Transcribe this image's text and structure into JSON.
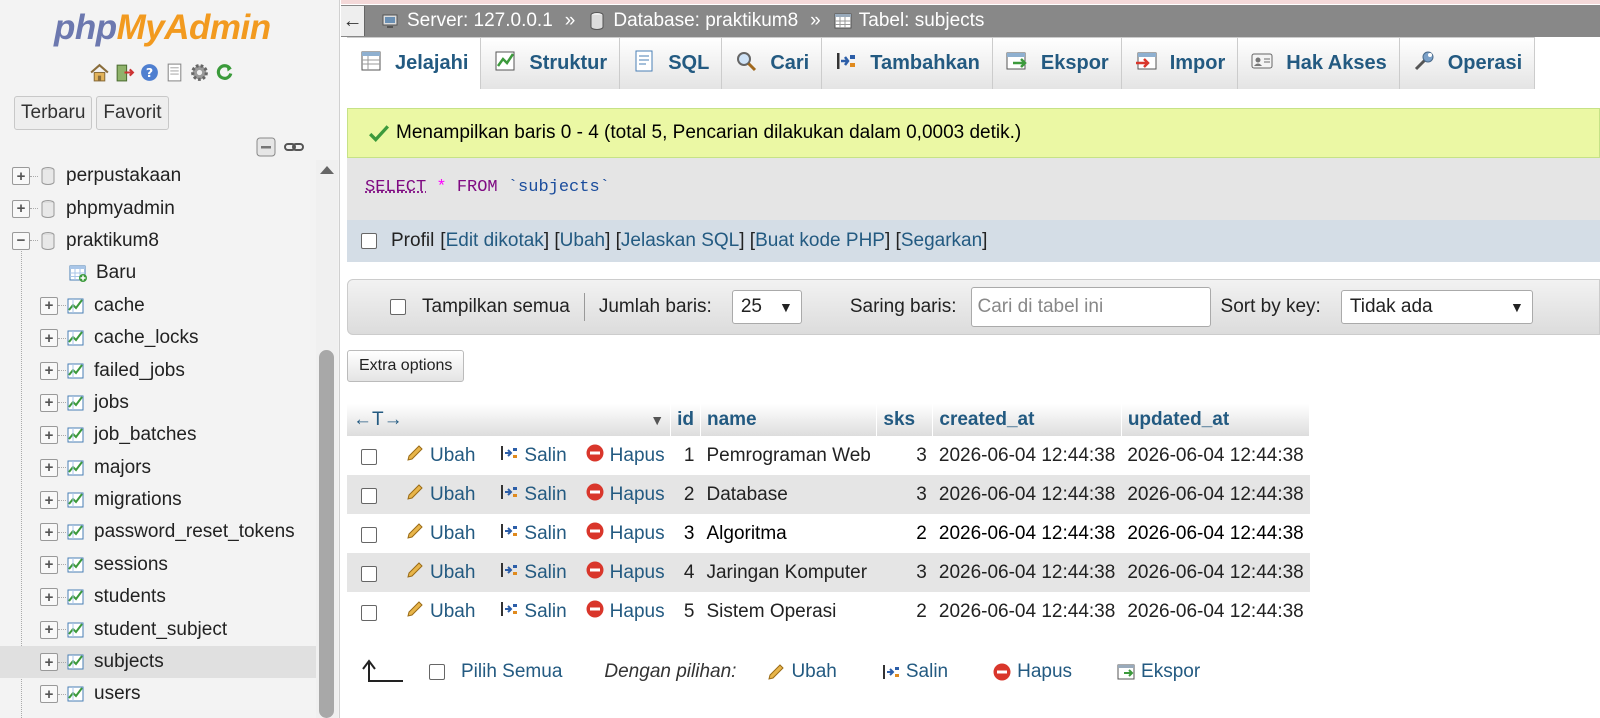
{
  "nav": {
    "logo_php": "php",
    "logo_myadmin": "MyAdmin",
    "quick_icons": [
      "home-icon",
      "logout-icon",
      "help-icon",
      "docs-icon",
      "settings-icon",
      "reload-icon"
    ],
    "recent_label": "Terbaru",
    "favorite_label": "Favorit",
    "databases": [
      {
        "name": "perpustakaan",
        "expanded": false
      },
      {
        "name": "phpmyadmin",
        "expanded": false
      },
      {
        "name": "praktikum8",
        "expanded": true
      }
    ],
    "new_label": "Baru",
    "tables": [
      "cache",
      "cache_locks",
      "failed_jobs",
      "jobs",
      "job_batches",
      "majors",
      "migrations",
      "password_reset_tokens",
      "sessions",
      "students",
      "student_subject",
      "subjects",
      "users"
    ],
    "active_table": "subjects"
  },
  "breadcrumb": {
    "server": "Server: 127.0.0.1",
    "database": "Database: praktikum8",
    "table": "Tabel: subjects",
    "separator": "»"
  },
  "tabs": [
    {
      "label": "Jelajahi",
      "icon": "browse-icon",
      "active": true
    },
    {
      "label": "Struktur",
      "icon": "structure-icon"
    },
    {
      "label": "SQL",
      "icon": "sql-icon"
    },
    {
      "label": "Cari",
      "icon": "search-icon"
    },
    {
      "label": "Tambahkan",
      "icon": "insert-icon"
    },
    {
      "label": "Ekspor",
      "icon": "export-icon"
    },
    {
      "label": "Impor",
      "icon": "import-icon"
    },
    {
      "label": "Hak Akses",
      "icon": "privileges-icon"
    },
    {
      "label": "Operasi",
      "icon": "operations-icon"
    }
  ],
  "message": "Menampilkan baris 0 - 4 (total 5, Pencarian dilakukan dalam 0,0003 detik.)",
  "sql": {
    "keyword_select": "SELECT",
    "star": "*",
    "keyword_from": "FROM",
    "table": "`subjects`"
  },
  "profil": {
    "label": "Profil",
    "links": [
      "Edit dikotak",
      "Ubah",
      "Jelaskan SQL",
      "Buat kode PHP",
      "Segarkan"
    ]
  },
  "navbar": {
    "show_all": "Tampilkan semua",
    "rows_label": "Jumlah baris:",
    "rows_value": "25",
    "filter_label": "Saring baris:",
    "filter_placeholder": "Cari di tabel ini",
    "sort_label": "Sort by key:",
    "sort_value": "Tidak ada"
  },
  "extra_options": "Extra options",
  "table": {
    "columns": [
      "id",
      "name",
      "sks",
      "created_at",
      "updated_at"
    ],
    "actions": {
      "edit": "Ubah",
      "copy": "Salin",
      "delete": "Hapus"
    },
    "rows": [
      {
        "id": "1",
        "name": "Pemrograman Web",
        "sks": "3",
        "created_at": "2026-06-04 12:44:38",
        "updated_at": "2026-06-04 12:44:38"
      },
      {
        "id": "2",
        "name": "Database",
        "sks": "3",
        "created_at": "2026-06-04 12:44:38",
        "updated_at": "2026-06-04 12:44:38"
      },
      {
        "id": "3",
        "name": "Algoritma",
        "sks": "2",
        "created_at": "2026-06-04 12:44:38",
        "updated_at": "2026-06-04 12:44:38"
      },
      {
        "id": "4",
        "name": "Jaringan Komputer",
        "sks": "3",
        "created_at": "2026-06-04 12:44:38",
        "updated_at": "2026-06-04 12:44:38"
      },
      {
        "id": "5",
        "name": "Sistem Operasi",
        "sks": "2",
        "created_at": "2026-06-04 12:44:38",
        "updated_at": "2026-06-04 12:44:38"
      }
    ]
  },
  "bottom": {
    "select_all": "Pilih Semua",
    "with_selected": "Dengan pilihan:",
    "edit": "Ubah",
    "copy": "Salin",
    "delete": "Hapus",
    "export": "Ekspor"
  },
  "colors": {
    "link": "#235a81",
    "success_bg": "#ebf8a4",
    "breadcrumb_bg": "#888888",
    "logo_php": "#6c78af",
    "logo_myadmin": "#f29a1f"
  }
}
